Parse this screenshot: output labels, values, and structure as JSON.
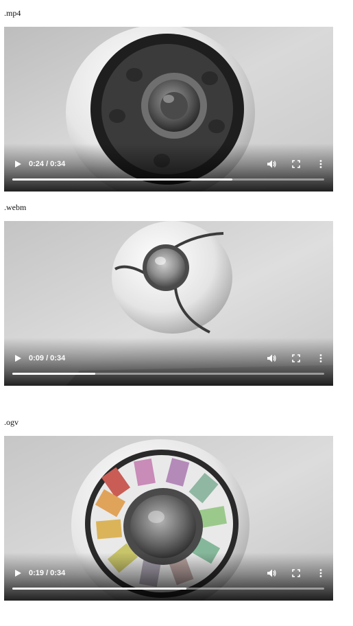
{
  "videos": [
    {
      "label": ".mp4",
      "time": "0:24 / 0:34",
      "progress": 0.706,
      "icons": {
        "play": "play-icon",
        "mute": "volume-icon",
        "fullscreen": "fullscreen-icon",
        "more": "more-options-icon"
      }
    },
    {
      "label": ".webm",
      "time": "0:09 / 0:34",
      "progress": 0.265,
      "icons": {
        "play": "play-icon",
        "mute": "volume-icon",
        "fullscreen": "fullscreen-icon",
        "more": "more-options-icon"
      }
    },
    {
      "label": ".ogv",
      "time": "0:19 / 0:34",
      "progress": 0.559,
      "icons": {
        "play": "play-icon",
        "mute": "volume-icon",
        "fullscreen": "fullscreen-icon",
        "more": "more-options-icon"
      }
    }
  ],
  "colors": {
    "control_text": "#ffffff",
    "progress_fill": "#ffffff",
    "progress_track": "rgba(255,255,255,0.45)"
  }
}
